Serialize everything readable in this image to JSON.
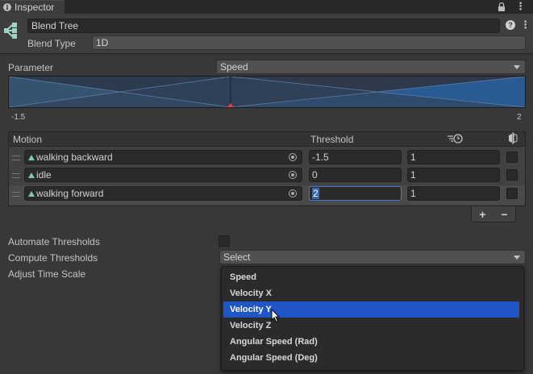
{
  "tab": {
    "title": "Inspector"
  },
  "header": {
    "name_value": "Blend Tree",
    "blend_type_label": "Blend Type",
    "blend_type_value": "1D"
  },
  "parameter": {
    "label": "Parameter",
    "value": "Speed"
  },
  "graph": {
    "min_label": "-1.5",
    "max_label": "2"
  },
  "motion_list": {
    "header_motion": "Motion",
    "header_threshold": "Threshold",
    "rows": [
      {
        "motion": "walking backward",
        "threshold": "-1.5",
        "speed": "1"
      },
      {
        "motion": "idle",
        "threshold": "0",
        "speed": "1"
      },
      {
        "motion": "walking forward",
        "threshold": "2",
        "speed": "1"
      }
    ],
    "add_label": "+",
    "remove_label": "−"
  },
  "settings": {
    "automate_label": "Automate Thresholds",
    "compute_label": "Compute Thresholds",
    "compute_value": "Select",
    "adjust_label": "Adjust Time Scale"
  },
  "popup": {
    "options": [
      "Speed",
      "Velocity X",
      "Velocity Y",
      "Velocity Z",
      "Angular Speed (Rad)",
      "Angular Speed (Deg)"
    ],
    "selected_index": 2
  },
  "colors": {
    "panel": "#383838",
    "selection": "#1f55c6",
    "graph_fill": "#2a5a92",
    "marker": "#e0413a"
  },
  "icons": [
    "info-icon",
    "lock-icon",
    "kebab-menu-icon",
    "blend-tree-icon",
    "help-icon",
    "animation-clip-icon",
    "object-picker-icon",
    "time-scale-icon",
    "mirror-icon",
    "drag-handle-icon",
    "mouse-cursor-icon"
  ]
}
